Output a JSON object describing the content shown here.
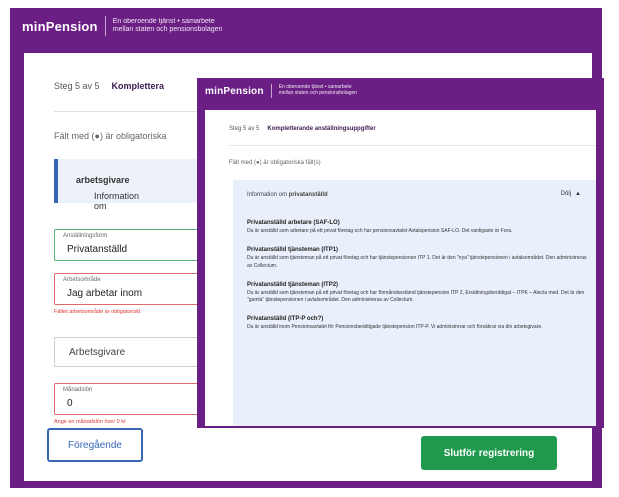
{
  "brand": {
    "logo": "minPension",
    "tagline_line1": "En oberoende tjänst • samarbete",
    "tagline_line2": "mellan staten och pensionsbolagen"
  },
  "back_window": {
    "step": "Steg 5 av 5",
    "step_title": "Komplettera",
    "required_note": "Fält med (●) är obligatoriska",
    "info_prefix": "Information om ",
    "info_bold": "arbetsgivare",
    "field1": {
      "label": "Anställningsform",
      "value": "Privatanställd"
    },
    "field2": {
      "label": "Arbetsområde",
      "value": "Jag arbetar inom",
      "error": "Fältet arbetsområde är obligatoriskt"
    },
    "select": {
      "value": "Arbetsgivare"
    },
    "field3": {
      "label": "Månadslön",
      "value": "0",
      "error": "Ange en månadslön över 0 kr"
    },
    "prev_button": "Föregående",
    "finish_button": "Slutför registrering"
  },
  "front_window": {
    "step": "Steg 5 av 5",
    "step_title": "Kompletterande anställningsuppgifter",
    "required_note": "Fält med (●) är obligatoriska fält(s)",
    "panel": {
      "heading_prefix": "Information om ",
      "heading_bold": "privatanställd",
      "toggle": "Dölj",
      "types": [
        {
          "title": "Privatanställd arbetare (SAF-LO)",
          "desc": "Du är anställd som arbetare på ett privat företag och har pensionsavtalet Avtalspension SAF-LO. Det vanligaste är Fora."
        },
        {
          "title": "Privatanställd tjänsteman (ITP1)",
          "desc": "Du är anställd som tjänsteman på ett privat företag och har tjänstepensionen ITP 1. Det är den \"nya\" tjänstepensionen i avtalsområdet. Den administreras av Collectum."
        },
        {
          "title": "Privatanställd tjänsteman (ITP2)",
          "desc": "Du är anställd som tjänsteman på ett privat företag och har förmånsbestämd tjänstepension ITP 2, Ersättningsberättigat – ITPK – Alecta med. Det är den \"gamla\" tjänstepensionen i avtalsområdet. Den administreras av Collectum."
        },
        {
          "title": "Privatanställd (ITP-P och?)",
          "desc": "Du är anställd inom Pensionsavtalet för Pensionsberättigade tjänstepension ITP-P. Vi administrerar och försäkrar via din arbetsgivare."
        }
      ]
    }
  },
  "colors": {
    "brand_purple": "#6b1e84",
    "info_blue": "#3567b5",
    "success_green": "#1f9a4c",
    "error_red": "#e06a6a"
  }
}
